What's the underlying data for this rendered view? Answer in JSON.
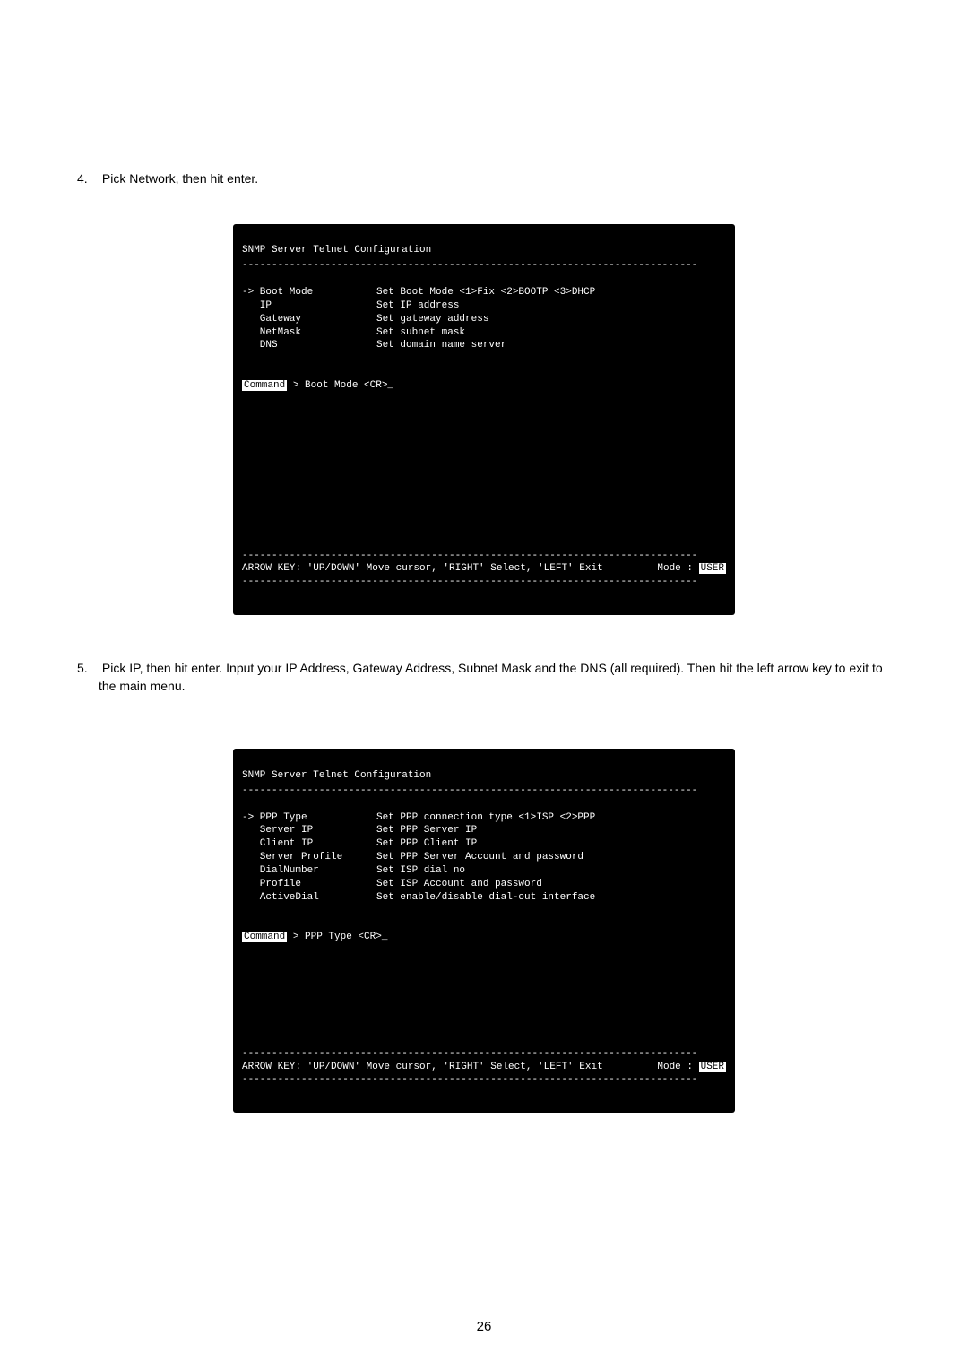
{
  "step4": {
    "num": "4.",
    "text": "Pick Network, then hit enter."
  },
  "step5": {
    "num": "5.",
    "text": "Pick IP, then hit enter.  Input your IP Address, Gateway Address, Subnet Mask and the DNS (all required).  Then hit the left arrow key to exit to the main menu."
  },
  "term1": {
    "title": "SNMP Server Telnet Configuration",
    "div": "-----------------------------------------------------------------------------",
    "menu": [
      {
        "label": "-> Boot Mode",
        "desc": "Set Boot Mode <1>Fix <2>BOOTP <3>DHCP"
      },
      {
        "label": "   IP",
        "desc": "Set IP address"
      },
      {
        "label": "   Gateway",
        "desc": "Set gateway address"
      },
      {
        "label": "   NetMask",
        "desc": "Set subnet mask"
      },
      {
        "label": "   DNS",
        "desc": "Set domain name server"
      }
    ],
    "cmd_label": "Command",
    "cmd_text": " > Boot Mode <CR>_",
    "status_left": "ARROW KEY: 'UP/DOWN' Move cursor, 'RIGHT' Select, 'LEFT' Exit",
    "status_mode_label": "Mode : ",
    "status_mode_value": "USER"
  },
  "term2": {
    "title": "SNMP Server Telnet Configuration",
    "div": "-----------------------------------------------------------------------------",
    "menu": [
      {
        "label": "-> PPP Type",
        "desc": "Set PPP connection type <1>ISP <2>PPP"
      },
      {
        "label": "   Server IP",
        "desc": "Set PPP Server IP"
      },
      {
        "label": "   Client IP",
        "desc": "Set PPP Client IP"
      },
      {
        "label": "   Server Profile",
        "desc": "Set PPP Server Account and password"
      },
      {
        "label": "   DialNumber",
        "desc": "Set ISP dial no"
      },
      {
        "label": "   Profile",
        "desc": "Set ISP Account and password"
      },
      {
        "label": "   ActiveDial",
        "desc": "Set enable/disable dial-out interface"
      }
    ],
    "cmd_label": "Command",
    "cmd_text": " > PPP Type <CR>_",
    "status_left": "ARROW KEY: 'UP/DOWN' Move cursor, 'RIGHT' Select, 'LEFT' Exit",
    "status_mode_label": "Mode : ",
    "status_mode_value": "USER"
  },
  "page_number": "26"
}
